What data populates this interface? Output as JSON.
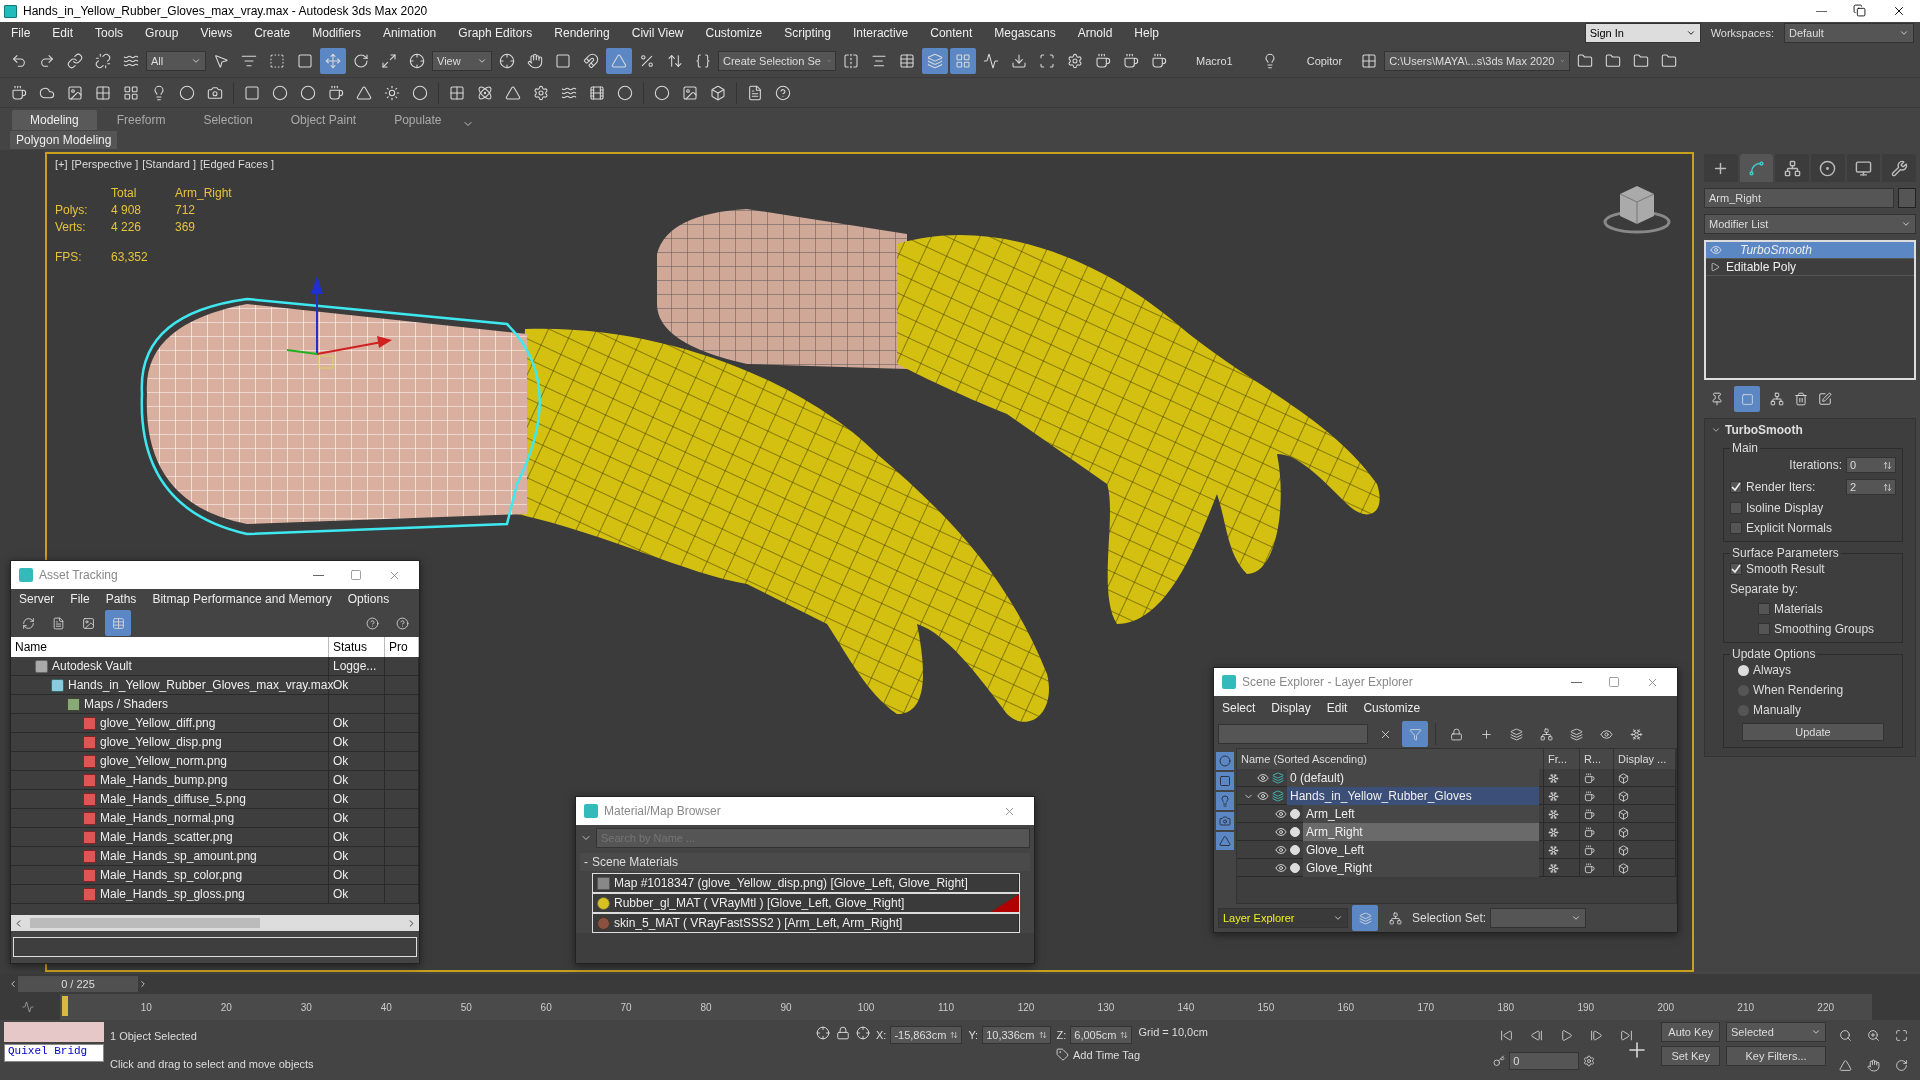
{
  "window": {
    "title": "Hands_in_Yellow_Rubber_Gloves_max_vray.max - Autodesk 3ds Max 2020"
  },
  "menu": [
    "File",
    "Edit",
    "Tools",
    "Group",
    "Views",
    "Create",
    "Modifiers",
    "Animation",
    "Graph Editors",
    "Rendering",
    "Civil View",
    "Customize",
    "Scripting",
    "Interactive",
    "Content",
    "Megascans",
    "Arnold",
    "Help"
  ],
  "account": {
    "sign_in": "Sign In",
    "workspaces_label": "Workspaces:",
    "workspace": "Default"
  },
  "main_toolbar": {
    "selection_filter": "All",
    "reference_coord": "View",
    "named_selection": "Create Selection Se",
    "macro": "Macro1",
    "copitor": "Copitor",
    "project_path": "C:\\Users\\MAYA\\...s\\3ds Max 2020"
  },
  "ribbon": {
    "tabs": [
      {
        "label": "Modeling",
        "selected": true
      },
      {
        "label": "Freeform",
        "selected": false
      },
      {
        "label": "Selection",
        "selected": false
      },
      {
        "label": "Object Paint",
        "selected": false
      },
      {
        "label": "Populate",
        "selected": false
      }
    ],
    "panel": "Polygon Modeling"
  },
  "viewport": {
    "labels": [
      "[+]",
      "[Perspective ]",
      "[Standard ]",
      "[Edged Faces ]"
    ],
    "stats": {
      "headers": [
        "Total",
        "Arm_Right"
      ],
      "rows": [
        {
          "label": "Polys:",
          "total": "4 908",
          "selection": "712"
        },
        {
          "label": "Verts:",
          "total": "4 226",
          "selection": "369"
        }
      ],
      "fps_label": "FPS:",
      "fps": "63,352"
    }
  },
  "command_panel": {
    "tabs": [
      {
        "kind": "create",
        "selected": false
      },
      {
        "kind": "modify",
        "selected": true
      },
      {
        "kind": "hierarchy",
        "selected": false
      },
      {
        "kind": "motion",
        "selected": false
      },
      {
        "kind": "display",
        "selected": false
      },
      {
        "kind": "utilities",
        "selected": false
      }
    ],
    "object_name": "Arm_Right",
    "modifier_list": "Modifier List",
    "stack": [
      {
        "label": "TurboSmooth",
        "kind": "modifier",
        "selected": true
      },
      {
        "label": "Editable Poly",
        "kind": "base",
        "selected": false
      }
    ],
    "rollout": {
      "title": "TurboSmooth",
      "groups": [
        {
          "title": "Main",
          "controls": [
            {
              "kind": "spinner",
              "label": "Iterations:",
              "value": "0"
            },
            {
              "kind": "check_spinner",
              "label": "Render Iters:",
              "checked": true,
              "value": "2"
            },
            {
              "kind": "checkbox",
              "label": "Isoline Display",
              "checked": false
            },
            {
              "kind": "checkbox",
              "label": "Explicit Normals",
              "checked": false
            }
          ]
        },
        {
          "title": "Surface Parameters",
          "controls": [
            {
              "kind": "checkbox",
              "label": "Smooth Result",
              "checked": true
            },
            {
              "kind": "caption",
              "label": "Separate by:"
            },
            {
              "kind": "sub_checkbox",
              "label": "Materials",
              "checked": false
            },
            {
              "kind": "sub_checkbox",
              "label": "Smoothing Groups",
              "checked": false
            }
          ]
        },
        {
          "title": "Update Options",
          "controls": [
            {
              "kind": "radio",
              "label": "Always",
              "selected": true
            },
            {
              "kind": "radio",
              "label": "When Rendering",
              "selected": false
            },
            {
              "kind": "radio",
              "label": "Manually",
              "selected": false
            },
            {
              "kind": "button",
              "label": "Update"
            }
          ]
        }
      ]
    }
  },
  "asset_tracking": {
    "title": "Asset Tracking",
    "menu": [
      "Server",
      "File",
      "Paths",
      "Bitmap Performance and Memory",
      "Options"
    ],
    "columns": [
      "Name",
      "Status",
      "Pro"
    ],
    "rows": [
      {
        "kind": "vault",
        "name": "Autodesk Vault",
        "status": "Logge...",
        "children": [
          {
            "kind": "scene",
            "name": "Hands_in_Yellow_Rubber_Gloves_max_vray.max",
            "status": "Ok",
            "children": [
              {
                "kind": "folder",
                "name": "Maps / Shaders",
                "children": [
                  {
                    "kind": "bitmap",
                    "name": "glove_Yellow_diff.png",
                    "status": "Ok"
                  },
                  {
                    "kind": "bitmap",
                    "name": "glove_Yellow_disp.png",
                    "status": "Ok"
                  },
                  {
                    "kind": "bitmap",
                    "name": "glove_Yellow_norm.png",
                    "status": "Ok"
                  },
                  {
                    "kind": "bitmap",
                    "name": "Male_Hands_bump.png",
                    "status": "Ok"
                  },
                  {
                    "kind": "bitmap",
                    "name": "Male_Hands_diffuse_5.png",
                    "status": "Ok"
                  },
                  {
                    "kind": "bitmap",
                    "name": "Male_Hands_normal.png",
                    "status": "Ok"
                  },
                  {
                    "kind": "bitmap",
                    "name": "Male_Hands_scatter.png",
                    "status": "Ok"
                  },
                  {
                    "kind": "bitmap",
                    "name": "Male_Hands_sp_amount.png",
                    "status": "Ok"
                  },
                  {
                    "kind": "bitmap",
                    "name": "Male_Hands_sp_color.png",
                    "status": "Ok"
                  },
                  {
                    "kind": "bitmap",
                    "name": "Male_Hands_sp_gloss.png",
                    "status": "Ok"
                  }
                ]
              }
            ]
          }
        ]
      }
    ]
  },
  "material_browser": {
    "title": "Material/Map Browser",
    "search_placeholder": "Search by Name ...",
    "group": {
      "toggle": "-",
      "title": "Scene Materials"
    },
    "items": [
      {
        "kind": "map",
        "label": "Map #1018347 (glove_Yellow_disp.png) [Glove_Left, Glove_Right]",
        "in_viewport": false
      },
      {
        "kind": "vray_mtl",
        "label": "Rubber_gl_MAT ( VRayMtl ) [Glove_Left, Glove_Right]",
        "in_viewport": true
      },
      {
        "kind": "sss",
        "label": "skin_5_MAT ( VRayFastSSS2 ) [Arm_Left, Arm_Right]",
        "in_viewport": false
      }
    ]
  },
  "scene_explorer": {
    "title": "Scene Explorer - Layer Explorer",
    "menu": [
      "Select",
      "Display",
      "Edit",
      "Customize"
    ],
    "columns": [
      "Name (Sorted Ascending)",
      "Fr...",
      "R...",
      "Display ..."
    ],
    "layers": [
      {
        "name": "0 (default)",
        "kind": "layer",
        "selected": false,
        "expanded": false
      },
      {
        "name": "Hands_in_Yellow_Rubber_Gloves",
        "kind": "layer",
        "selected": true,
        "expanded": true,
        "children": [
          {
            "name": "Arm_Left",
            "kind": "object",
            "selected": false
          },
          {
            "name": "Arm_Right",
            "kind": "object",
            "selected": true
          },
          {
            "name": "Glove_Left",
            "kind": "object",
            "selected": false
          },
          {
            "name": "Glove_Right",
            "kind": "object",
            "selected": false
          }
        ]
      }
    ],
    "explorer_mode": "Layer Explorer",
    "selection_set_label": "Selection Set:"
  },
  "timeline": {
    "frame_counter": "0 / 225",
    "ticks": [
      "10",
      "20",
      "30",
      "40",
      "50",
      "60",
      "70",
      "80",
      "90",
      "100",
      "110",
      "120",
      "130",
      "140",
      "150",
      "160",
      "170",
      "180",
      "190",
      "200",
      "210",
      "220"
    ]
  },
  "status": {
    "selection": "1 Object Selected",
    "prompt": "Click and drag to select and move objects",
    "script_listener": "Quixel Bridg",
    "coords": [
      {
        "axis": "X:",
        "value": "-15,863cm"
      },
      {
        "axis": "Y:",
        "value": "10,336cm"
      },
      {
        "axis": "Z:",
        "value": "6,005cm"
      }
    ],
    "grid": "Grid = 10,0cm",
    "add_time_tag": "Add Time Tag",
    "auto_key": "Auto Key",
    "key_mode": "Selected",
    "set_key": "Set Key",
    "key_filters": "Key Filters...",
    "current_frame": "0"
  }
}
